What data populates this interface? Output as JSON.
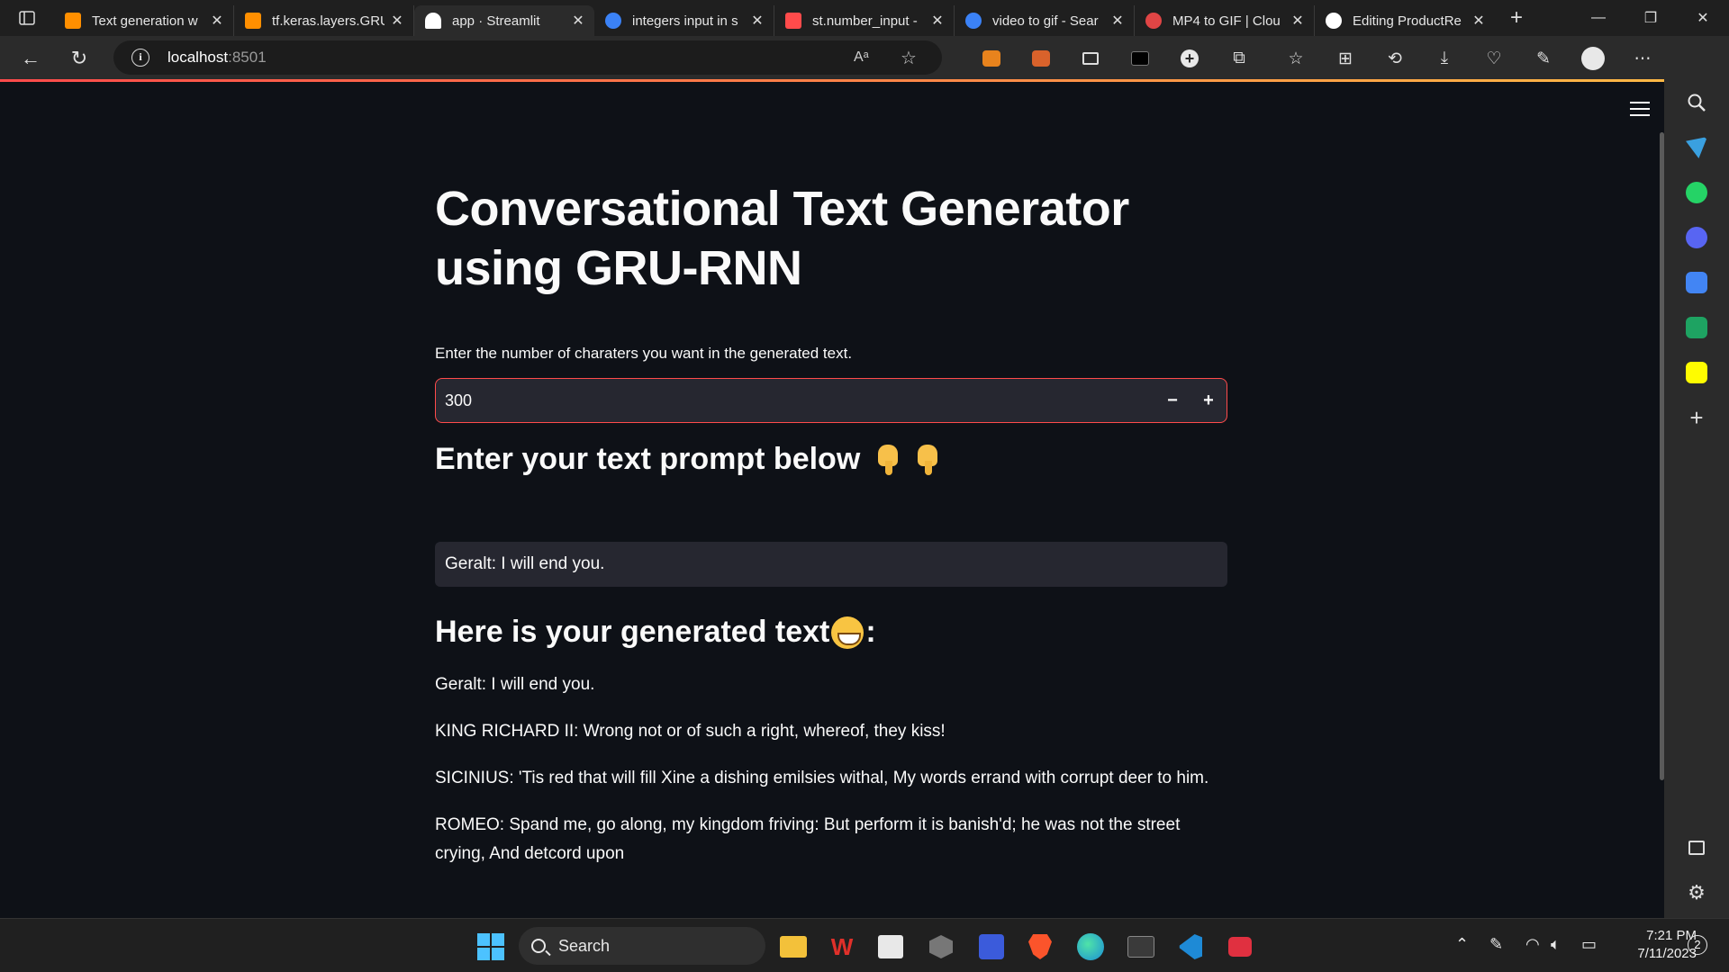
{
  "browser": {
    "tabs": [
      {
        "title": "Text generation w",
        "favicon_color": "#ff8f00",
        "active": false
      },
      {
        "title": "tf.keras.layers.GRU",
        "favicon_color": "#ff8f00",
        "active": false
      },
      {
        "title": "app · Streamlit",
        "favicon_color": "#ffffff",
        "active": true
      },
      {
        "title": "integers input in s",
        "favicon_color": "#3b82f6",
        "active": false
      },
      {
        "title": "st.number_input -",
        "favicon_color": "#ff4b4b",
        "active": false
      },
      {
        "title": "video to gif - Sear",
        "favicon_color": "#3b82f6",
        "active": false
      },
      {
        "title": "MP4 to GIF | Clou",
        "favicon_color": "#e04545",
        "active": false
      },
      {
        "title": "Editing ProductRe",
        "favicon_color": "#ffffff",
        "active": false
      }
    ],
    "address": {
      "host": "localhost",
      "port": ":8501"
    }
  },
  "app": {
    "title": "Conversational Text Generator using GRU-RNN",
    "number_input": {
      "label": "Enter the number of charaters you want in the generated text.",
      "value": "300",
      "minus": "−",
      "plus": "+"
    },
    "prompt_heading": "Enter your text prompt below",
    "prompt_value": "Geralt: I will end you.",
    "generated_heading": "Here is your generated text",
    "generated_heading_suffix": ":",
    "generated_paragraphs": [
      "Geralt: I will end you.",
      "KING RICHARD II: Wrong not or of such a right, whereof, they kiss!",
      "SICINIUS: 'Tis red that will fill Xine a dishing emilsies withal, My words errand with corrupt deer to him.",
      "ROMEO: Spand me, go along, my kingdom friving: But perform it is banish'd; he was not the street crying, And detcord upon"
    ]
  },
  "taskbar": {
    "search_label": "Search",
    "time": "7:21 PM",
    "date": "7/11/2023",
    "notification_count": "2"
  },
  "colors": {
    "accent": "#ff4b4b",
    "background": "#0e1117",
    "input_bg": "#262730"
  }
}
